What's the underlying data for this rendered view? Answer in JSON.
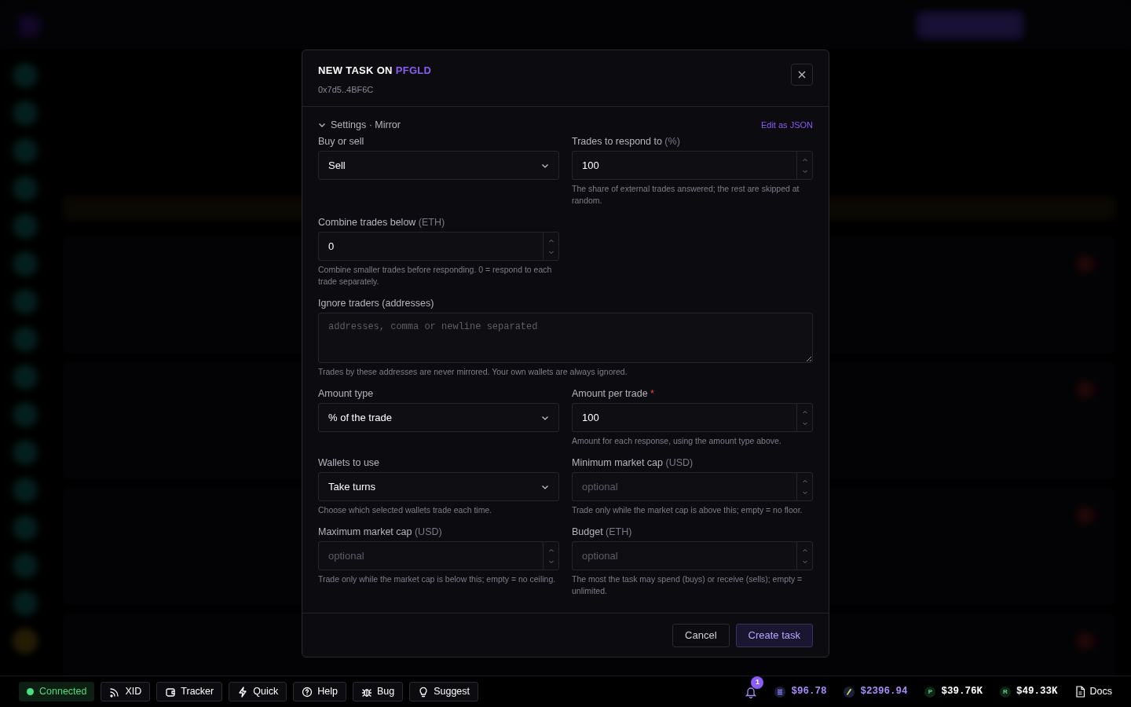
{
  "dialog": {
    "title": "NEW TASK ON",
    "token": "PFGLD",
    "address": "0x7d5..4BF6C",
    "section": {
      "label": "Settings · Mirror",
      "expanded": true,
      "action": "Edit as JSON"
    },
    "rows": [
      {
        "fields": [
          {
            "kind": "select",
            "label": "Buy or sell",
            "value": "Sell"
          },
          {
            "kind": "number",
            "label": "Trades to respond to",
            "unit": "(%)",
            "value": "100",
            "help": "The share of external trades answered; the rest are skipped at random."
          }
        ]
      },
      {
        "fields": [
          {
            "kind": "number",
            "label": "Combine trades below",
            "unit": "(ETH)",
            "value": "0",
            "help": "Combine smaller trades before responding. 0 = respond to each trade separately."
          }
        ]
      },
      {
        "fields": [
          {
            "kind": "textarea",
            "label": "Ignore traders (addresses)",
            "placeholder": "addresses, comma or newline separated",
            "help": "Trades by these addresses are never mirrored. Your own wallets are always ignored."
          }
        ]
      },
      {
        "fields": [
          {
            "kind": "select",
            "label": "Amount type",
            "value": "% of the trade"
          },
          {
            "kind": "number",
            "label": "Amount per trade",
            "required_mark": "*",
            "value": "100",
            "help": "Amount for each response, using the amount type above."
          }
        ]
      },
      {
        "fields": [
          {
            "kind": "select",
            "label": "Wallets to use",
            "value": "Take turns",
            "help": "Choose which selected wallets trade each time."
          },
          {
            "kind": "number",
            "label": "Minimum market cap",
            "unit": "(USD)",
            "placeholder": "optional",
            "help": "Trade only while the market cap is above this; empty = no floor."
          }
        ]
      },
      {
        "fields": [
          {
            "kind": "number",
            "label": "Maximum market cap",
            "unit": "(USD)",
            "placeholder": "optional",
            "help": "Trade only while the market cap is below this; empty = no ceiling."
          },
          {
            "kind": "number",
            "label": "Budget",
            "unit": "(ETH)",
            "placeholder": "optional",
            "help": "The most the task may spend (buys) or receive (sells); empty = unlimited."
          }
        ]
      }
    ],
    "buttons": [
      {
        "kind": "secondary",
        "label": "Cancel"
      },
      {
        "kind": "primary",
        "label": "Create task"
      }
    ]
  },
  "status_bar": {
    "connection": {
      "label": "Connected",
      "on": true
    },
    "tools": [
      "XID",
      "Tracker",
      "Quick",
      "Help",
      "Bug",
      "Suggest"
    ],
    "notifications": "1",
    "prices": [
      {
        "value": "$96.78",
        "color": "#a78bfa"
      },
      {
        "value": "$2396.94",
        "color": "#a78bfa"
      },
      {
        "letter": "P",
        "value": "$39.76K",
        "color": "#ffffff"
      },
      {
        "letter": "R",
        "value": "$49.33K",
        "color": "#ffffff"
      }
    ],
    "docs": "Docs"
  }
}
